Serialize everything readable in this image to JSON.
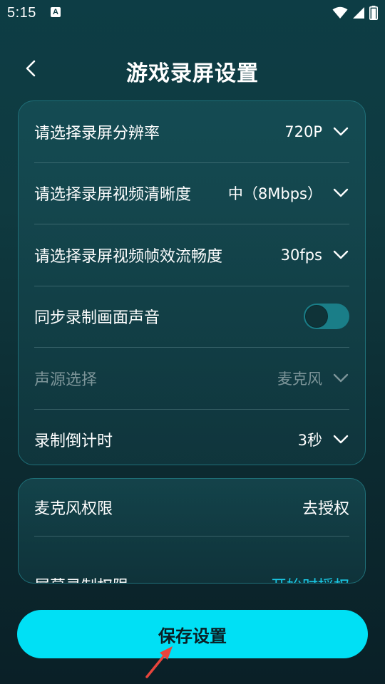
{
  "status_bar": {
    "time": "5:15",
    "notification_glyph": "A",
    "icons": [
      "wifi-icon",
      "signal-icon",
      "battery-icon"
    ]
  },
  "header": {
    "back_icon": "back-chevron-icon",
    "title": "游戏录屏设置"
  },
  "settings": {
    "rows": [
      {
        "label": "请选择录屏分辨率",
        "value": "720P"
      },
      {
        "label": "请选择录屏视频清晰度",
        "value": "中（8Mbps）"
      },
      {
        "label": "请选择录屏视频帧效流畅度",
        "value": "30fps"
      },
      {
        "label": "同步录制画面声音",
        "toggle_on": true
      },
      {
        "label": "声源选择",
        "value": "麦克风",
        "disabled": true
      },
      {
        "label": "录制倒计时",
        "value": "3秒"
      }
    ]
  },
  "permissions": {
    "rows": [
      {
        "label": "麦克风权限",
        "action": "去授权"
      },
      {
        "label": "屏幕录制权限",
        "action": "开始时授权"
      }
    ]
  },
  "save_button": {
    "label": "保存设置"
  },
  "colors": {
    "background_top": "#0d3d45",
    "background_bottom": "#0a2027",
    "card_border": "#1f6f78",
    "toggle_track": "#1a7e88",
    "accent": "#19c9e6",
    "button": "#00e0f5",
    "pointer_arrow": "#e8453c"
  }
}
